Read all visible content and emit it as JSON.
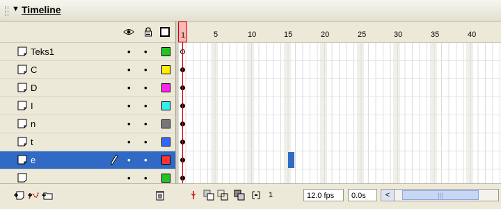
{
  "panel": {
    "title": "Timeline"
  },
  "layers": [
    {
      "name": "Teks1",
      "color": "#22c322",
      "selected": false,
      "keyframe": "empty"
    },
    {
      "name": "C",
      "color": "#ffee00",
      "selected": false,
      "keyframe": "filled"
    },
    {
      "name": "D",
      "color": "#ff22ee",
      "selected": false,
      "keyframe": "filled"
    },
    {
      "name": "I",
      "color": "#33eeee",
      "selected": false,
      "keyframe": "filled"
    },
    {
      "name": "n",
      "color": "#777777",
      "selected": false,
      "keyframe": "filled"
    },
    {
      "name": "t",
      "color": "#3366ff",
      "selected": false,
      "keyframe": "filled"
    },
    {
      "name": "e",
      "color": "#ff3333",
      "selected": true,
      "keyframe": "filled"
    }
  ],
  "ruler": {
    "current_frame_label": "1",
    "labels": [
      "5",
      "10",
      "15",
      "20",
      "25",
      "30",
      "35",
      "40"
    ]
  },
  "selection": {
    "layer": "e",
    "frame": 15
  },
  "status": {
    "frame": "1",
    "fps": "12.0 fps",
    "time": "0.0s"
  },
  "icons": {
    "eye": "eye-icon",
    "lock": "lock-icon",
    "outline": "outline-icon",
    "insert_layer": "insert-layer-icon",
    "motion_guide": "add-motion-guide-icon",
    "layer_folder": "insert-layer-folder-icon",
    "delete": "trash-icon"
  }
}
